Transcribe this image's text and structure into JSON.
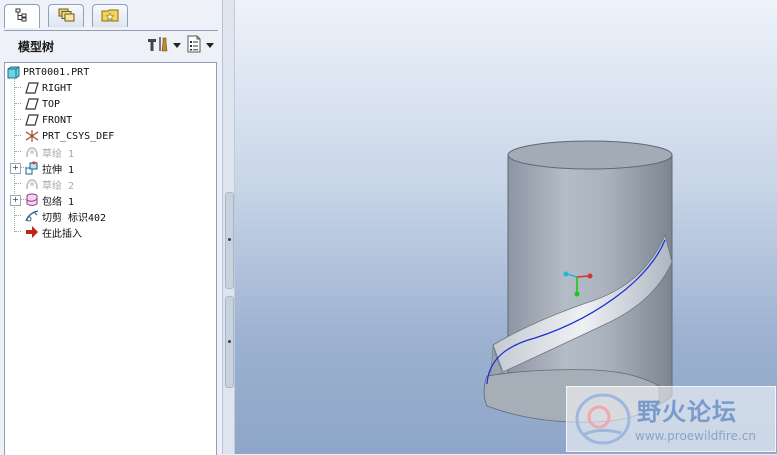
{
  "tabs": [
    {
      "icon": "model-tree-icon",
      "active": true
    },
    {
      "icon": "layers-icon",
      "active": false
    },
    {
      "icon": "favorites-folder-icon",
      "active": false
    }
  ],
  "model_tree": {
    "title": "模型树",
    "items": [
      {
        "label": "PRT0001.PRT",
        "icon": "part-icon",
        "dim": false
      },
      {
        "label": "RIGHT",
        "icon": "datum-plane-icon",
        "dim": false
      },
      {
        "label": "TOP",
        "icon": "datum-plane-icon",
        "dim": false
      },
      {
        "label": "FRONT",
        "icon": "datum-plane-icon",
        "dim": false
      },
      {
        "label": "PRT_CSYS_DEF",
        "icon": "csys-icon",
        "dim": false
      },
      {
        "label": "草绘 1",
        "icon": "sketch-icon",
        "dim": true
      },
      {
        "label": "拉伸 1",
        "icon": "extrude-icon",
        "dim": false,
        "expandable": true
      },
      {
        "label": "草绘 2",
        "icon": "sketch-icon",
        "dim": true
      },
      {
        "label": "包络 1",
        "icon": "wrap-icon",
        "dim": false,
        "expandable": true
      },
      {
        "label": "切剪 标识402",
        "icon": "cut-icon",
        "dim": false
      },
      {
        "label": "在此插入",
        "icon": "insert-here-arrow-icon",
        "dim": false
      }
    ]
  },
  "toolbar": {
    "settings_icon": "tree-settings-icon",
    "show_icon": "tree-show-icon"
  },
  "watermark": {
    "title": "野火论坛",
    "url": "www.proewildfire.cn"
  }
}
